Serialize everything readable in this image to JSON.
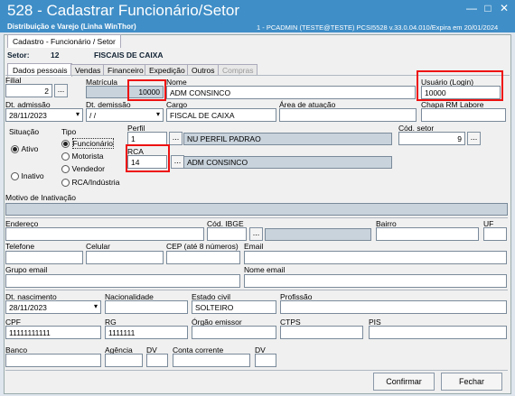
{
  "window": {
    "title": "528 - Cadastrar Funcionário/Setor",
    "subtitle": "Distribuição e Varejo (Linha WinThor)",
    "info": "1 - PCADMIN (TESTE@TESTE)   PCSI5528  v.33.0.04.010/Expira em 20/01/2024",
    "min": "—",
    "max": "□",
    "close": "✕"
  },
  "page_tab": "Cadastro - Funcionário / Setor",
  "setor": {
    "label": "Setor:",
    "code": "12",
    "name": "FISCAIS DE CAIXA"
  },
  "tabs": [
    "Dados pessoais",
    "Vendas",
    "Financeiro",
    "Expedição",
    "Outros",
    "Compras"
  ],
  "form": {
    "filial_label": "Filial",
    "filial": "2",
    "matricula_label": "Matrícula",
    "matricula": "10000",
    "nome_label": "Nome",
    "nome": "ADM CONSINCO",
    "usuario_label": "Usuário (Login)",
    "usuario": "10000",
    "dt_admissao_label": "Dt. admissão",
    "dt_admissao": "28/11/2023",
    "dt_demissao_label": "Dt. demissão",
    "dt_demissao": " / /",
    "cargo_label": "Cargo",
    "cargo": "FISCAL DE CAIXA",
    "area_label": "Área de atuação",
    "area": "",
    "chapa_label": "Chapa RM Labore",
    "chapa": "",
    "situacao_label": "Situação",
    "ativo": "Ativo",
    "inativo": "Inativo",
    "tipo_label": "Tipo",
    "tipo_opts": [
      "Funcionário",
      "Motorista",
      "Vendedor",
      "RCA/Indústria"
    ],
    "perfil_label": "Perfil",
    "perfil_code": "1",
    "perfil_name": "NU PERFIL PADRAO",
    "cod_setor_label": "Cód. setor",
    "cod_setor": "9",
    "rca_label": "RCA",
    "rca_code": "14",
    "rca_name": "ADM CONSINCO",
    "motivo_label": "Motivo de Inativação",
    "endereco_label": "Endereço",
    "cod_ibge_label": "Cód. IBGE",
    "bairro_label": "Bairro",
    "uf_label": "UF",
    "telefone_label": "Telefone",
    "celular_label": "Celular",
    "cep_label": "CEP (até 8 números)",
    "email_label": "Email",
    "grupo_email_label": "Grupo email",
    "nome_email_label": "Nome email",
    "dt_nasc_label": "Dt. nascimento",
    "dt_nasc": "28/11/2023",
    "nacionalidade_label": "Nacionalidade",
    "estado_civil_label": "Estado civil",
    "estado_civil": "SOLTEIRO",
    "profissao_label": "Profissão",
    "cpf_label": "CPF",
    "cpf": "11111111111",
    "rg_label": "RG",
    "rg": "1111111",
    "orgao_label": "Órgão emissor",
    "ctps_label": "CTPS",
    "pis_label": "PIS",
    "banco_label": "Banco",
    "agencia_label": "Agência",
    "dv_label": "DV",
    "conta_label": "Conta corrente",
    "dv2_label": "DV"
  },
  "buttons": {
    "confirmar": "Confirmar",
    "fechar": "Fechar"
  },
  "dots": "..."
}
